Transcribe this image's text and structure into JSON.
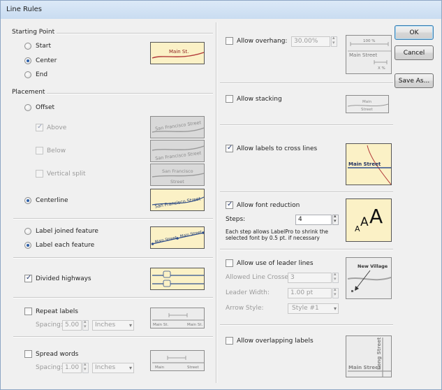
{
  "window": {
    "title": "Line Rules"
  },
  "starting_point": {
    "group_label": "Starting Point",
    "options": [
      "Start",
      "Center",
      "End"
    ],
    "selected": "Center",
    "preview_text": "Main St."
  },
  "placement": {
    "group_label": "Placement",
    "offset_label": "Offset",
    "above_label": "Above",
    "below_label": "Below",
    "vertical_split_label": "Vertical split",
    "centerline_label": "Centerline",
    "preview_text": "San Francisco Street",
    "split_top": "San Francisco",
    "split_bottom": "Street"
  },
  "joined": {
    "label_joined": "Label joined feature",
    "label_each": "Label each feature",
    "preview_text": "Main Street"
  },
  "divided": {
    "label": "Divided highways"
  },
  "repeat": {
    "label": "Repeat labels",
    "spacing_label": "Spacing:",
    "spacing_value": "5.00",
    "units": "Inches",
    "preview_left": "Main St.",
    "preview_right": "Main St."
  },
  "spread": {
    "label": "Spread words",
    "spacing_label": "Spacing:",
    "spacing_value": "1.00",
    "units": "Inches",
    "preview_left": "Main",
    "preview_right": "Street"
  },
  "overhang": {
    "label": "Allow overhang:",
    "value": "30.00%",
    "preview_pct": "100 %",
    "preview_text": "Main Street",
    "preview_x": "X %"
  },
  "stacking": {
    "label": "Allow stacking",
    "preview_top": "Main",
    "preview_bottom": "Street"
  },
  "cross": {
    "label": "Allow labels to cross lines",
    "preview_text": "Main Street"
  },
  "font_reduction": {
    "label": "Allow font reduction",
    "steps_label": "Steps:",
    "steps_value": "4",
    "note": "Each step allows LabelPro to shrink the selected font by 0.5 pt. if necessary"
  },
  "leader": {
    "label": "Allow use of leader lines",
    "crosses_label": "Allowed Line Crosses:",
    "crosses_value": "3",
    "width_label": "Leader Width:",
    "width_value": "1.00 pt",
    "arrow_label": "Arrow Style:",
    "arrow_value": "Style #1",
    "preview_text": "New Village"
  },
  "overlap": {
    "label": "Allow overlapping labels",
    "preview_h": "Main Street",
    "preview_v": "Long Street"
  },
  "buttons": {
    "ok": "OK",
    "cancel": "Cancel",
    "save_as": "Save As..."
  }
}
